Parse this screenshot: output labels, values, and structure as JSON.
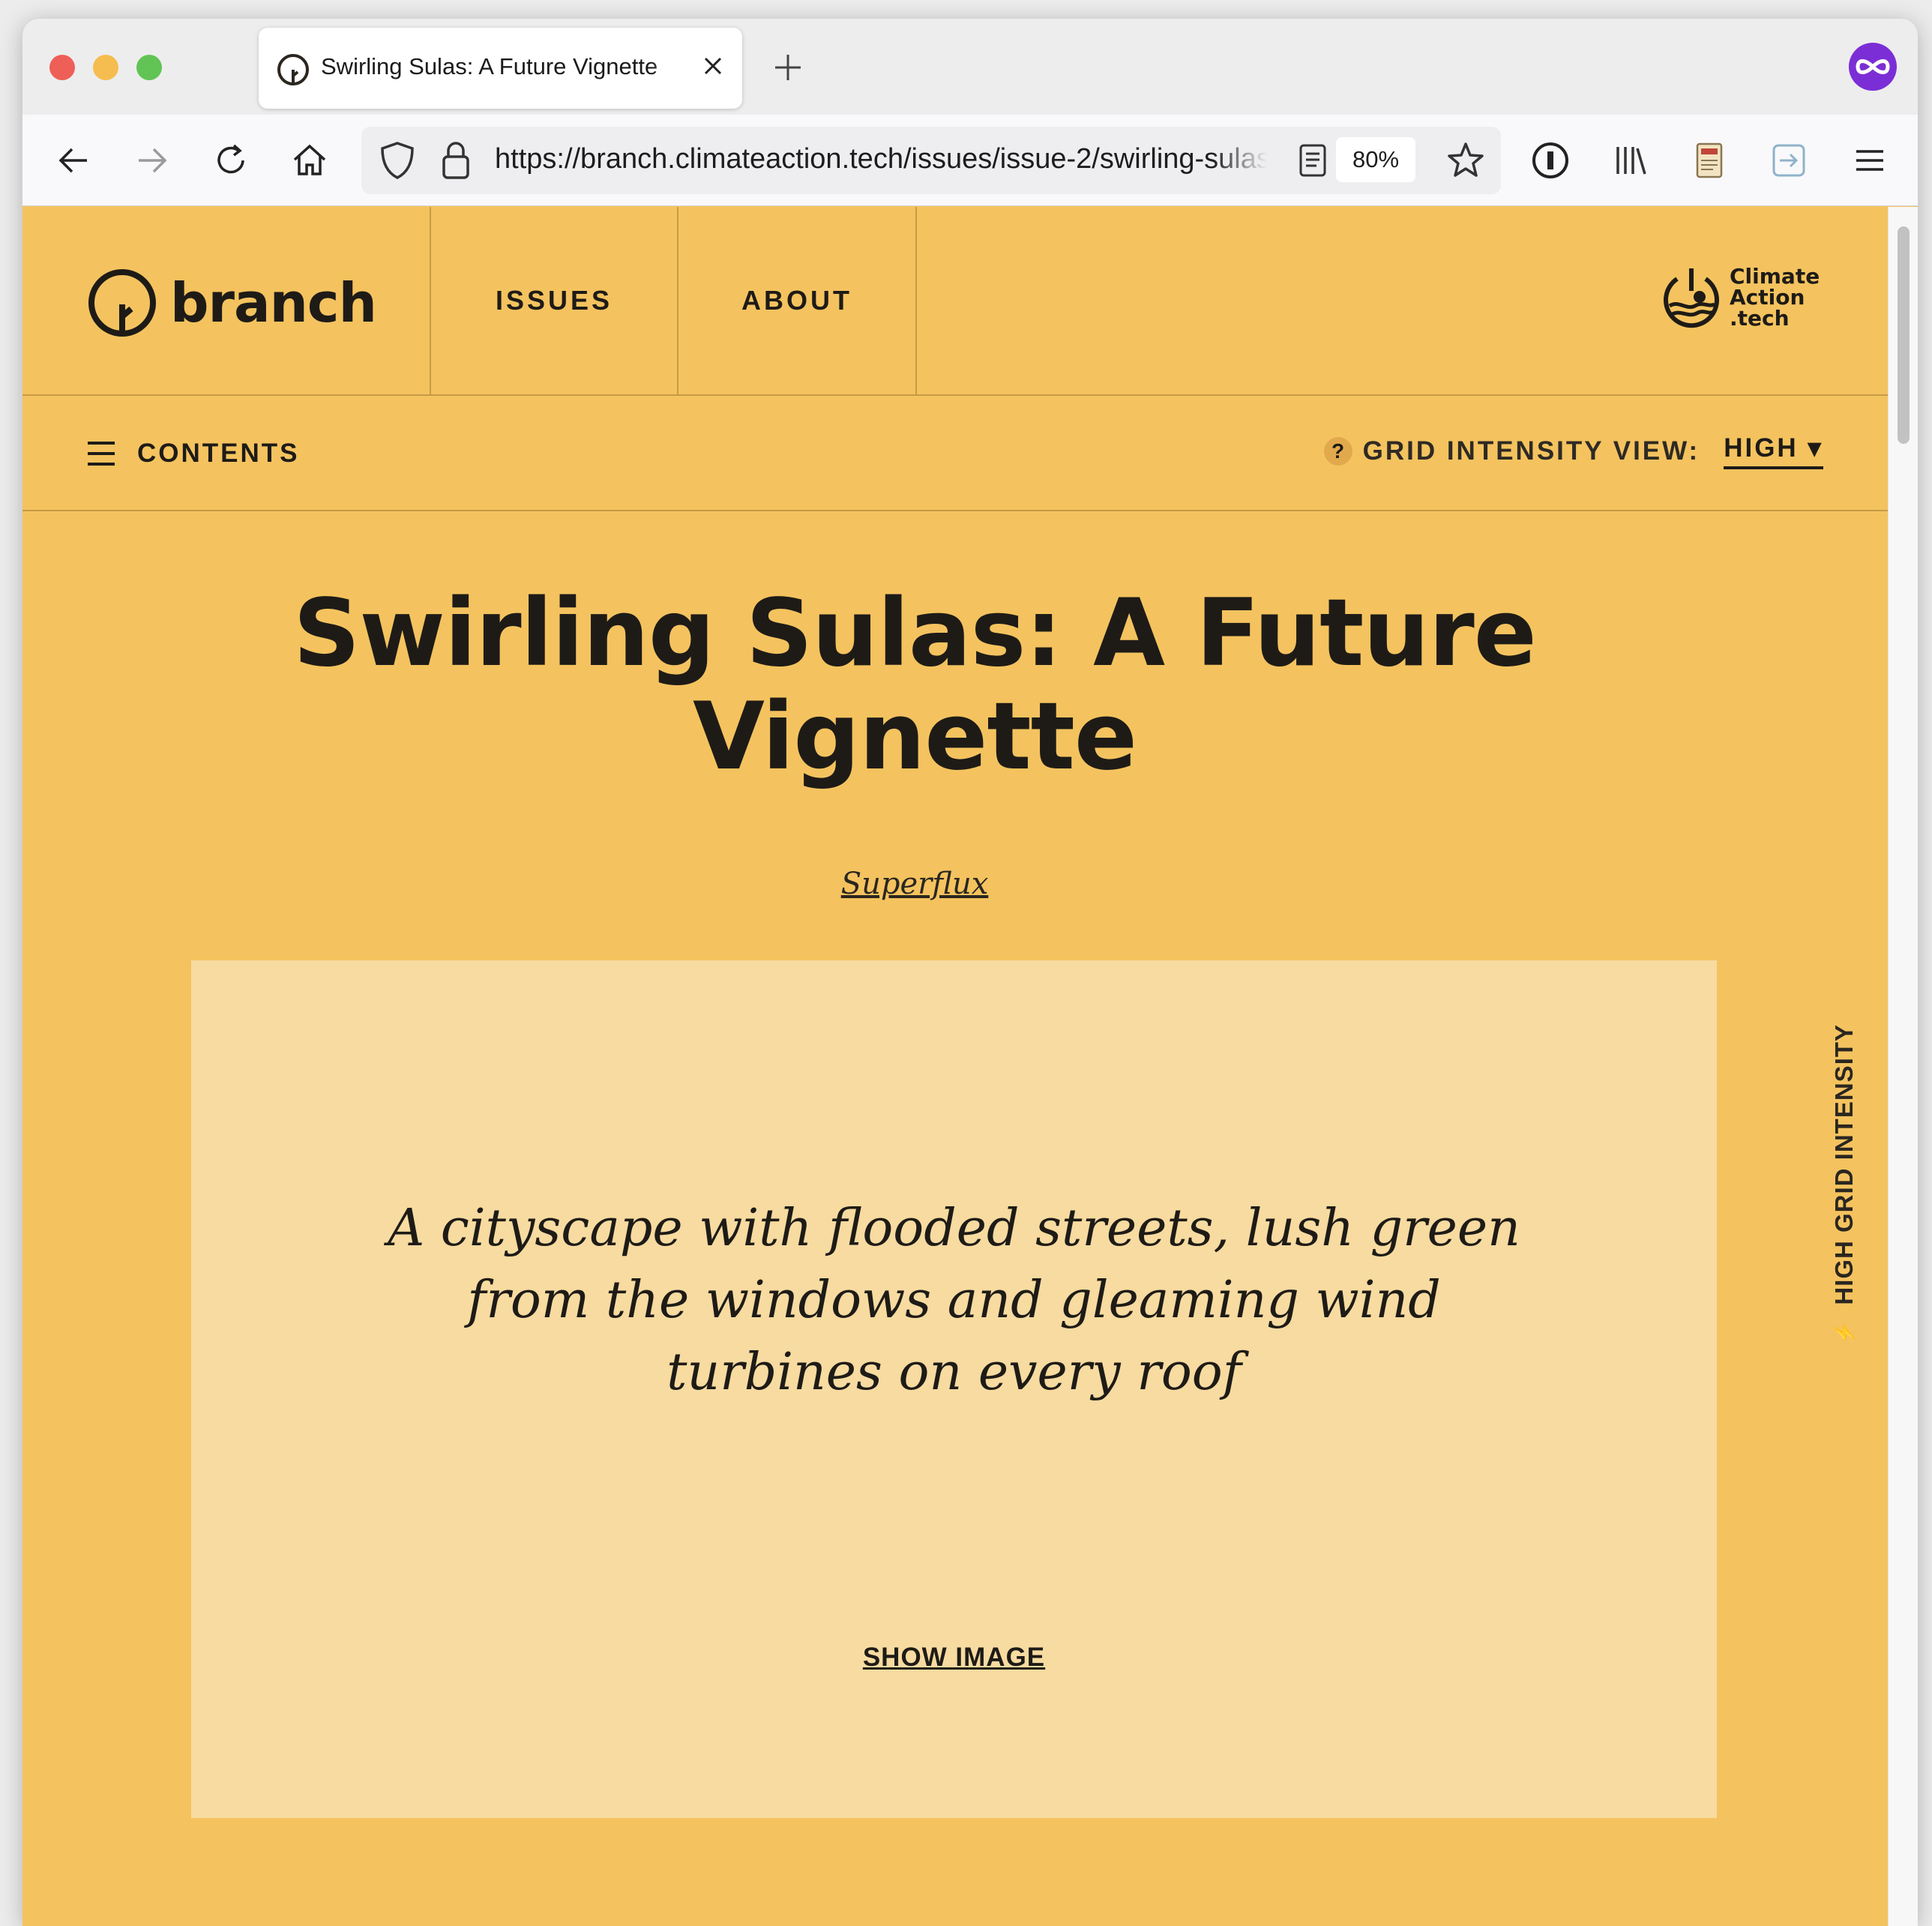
{
  "browser": {
    "tab_title": "Swirling Sulas: A Future Vignette",
    "url": "https://branch.climateaction.tech/issues/issue-2/swirling-sulas",
    "zoom": "80%"
  },
  "site": {
    "logo_text": "branch",
    "nav": {
      "issues": "ISSUES",
      "about": "ABOUT"
    },
    "partner_logo": {
      "line1": "Climate",
      "line2": "Action",
      "line3": ".tech"
    },
    "contents_label": "CONTENTS",
    "grid_intensity_label": "GRID INTENSITY VIEW:",
    "grid_intensity_value": "HIGH ▾",
    "side_label": "HIGH GRID INTENSITY"
  },
  "article": {
    "title": "Swirling Sulas: A Future Vignette",
    "author": "Superflux",
    "image_alt": "A cityscape with flooded streets, lush green from the windows and gleaming wind turbines on every roof",
    "show_image": "SHOW IMAGE"
  },
  "colors": {
    "page_background": "#f4c35f",
    "image_placeholder": "#f7dba0",
    "text": "#1e1b17"
  }
}
